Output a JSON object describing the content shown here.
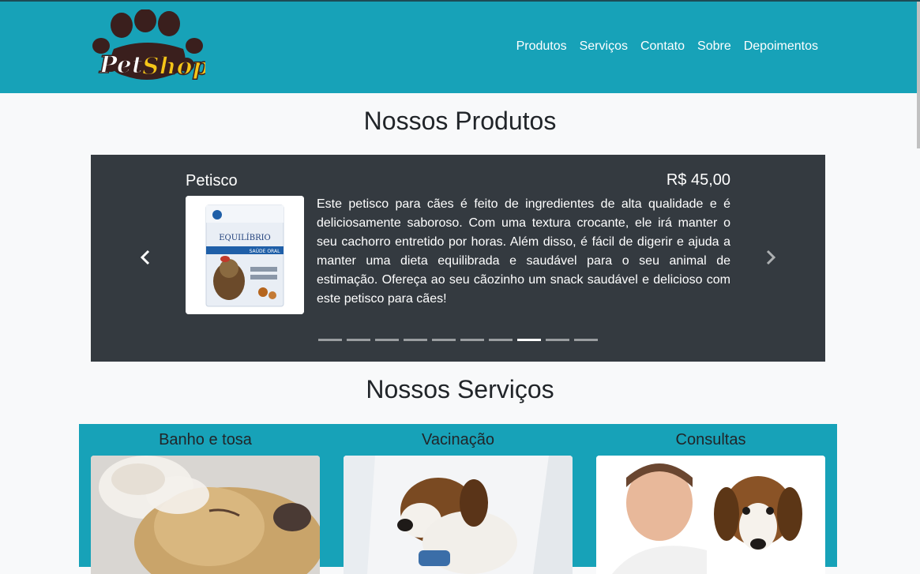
{
  "brand": {
    "logo_text_1": "Pet",
    "logo_text_2": "Shop",
    "colors": {
      "primary": "#17a2b8",
      "dark": "#343a40",
      "logo_brown": "#3a1f1d",
      "logo_yellow": "#f5c518"
    }
  },
  "nav": {
    "items": [
      "Produtos",
      "Serviços",
      "Contato",
      "Sobre",
      "Depoimentos"
    ]
  },
  "products": {
    "title": "Nossos Produtos",
    "slide": {
      "name": "Petisco",
      "price": "R$ 45,00",
      "description": "Este petisco para cães é feito de ingredientes de alta qualidade e é deliciosamente saboroso. Com uma textura crocante, ele irá manter o seu cachorro entretido por horas. Além disso, é fácil de digerir e ajuda a manter uma dieta equilibrada e saudável para o seu animal de estimação. Ofereça ao seu cãozinho um snack saudável e delicioso com este petisco para cães!",
      "package_brand": "EQUILÍBRIO",
      "package_label": "SAÚDE ORAL"
    },
    "controls": {
      "prev_icon": "chevron-left-icon",
      "next_icon": "chevron-right-icon"
    },
    "indicator_count": 10,
    "active_index": 7
  },
  "services": {
    "title": "Nossos Serviços",
    "items": [
      {
        "name": "Banho e tosa"
      },
      {
        "name": "Vacinação"
      },
      {
        "name": "Consultas"
      }
    ]
  }
}
